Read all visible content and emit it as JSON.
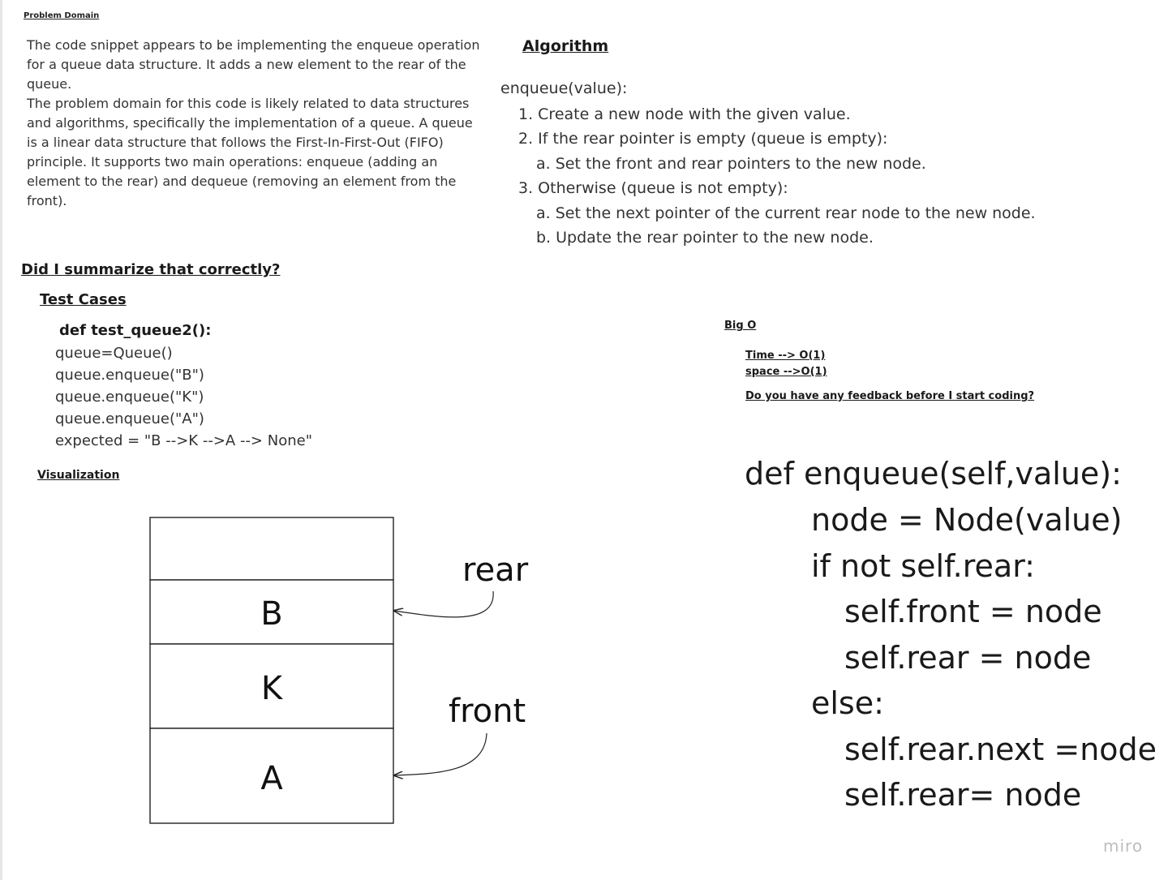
{
  "problem": {
    "title": "Problem Domain",
    "paragraph1": "The code snippet appears to be implementing the enqueue operation for a queue data structure. It adds a new element to the rear of the queue.",
    "paragraph2": "The problem domain for this code is likely related to data structures and algorithms, specifically the implementation of a queue. A queue is a linear data structure that follows the First-In-First-Out (FIFO) principle. It supports two main operations: enqueue (adding an element to the rear) and dequeue (removing an element from the front)."
  },
  "algorithm": {
    "title": "Algorithm",
    "head": "enqueue(value):",
    "steps": [
      "1. Create a new node with the given value.",
      "2. If the rear pointer is empty (queue is empty):",
      "a. Set the front and rear pointers to the new node.",
      "3. Otherwise (queue is not empty):",
      "a. Set the next pointer of the current rear node to the new node.",
      "b. Update the rear pointer to the new node."
    ]
  },
  "summary_question": "Did I summarize that correctly?",
  "test_cases": {
    "title": "Test Cases",
    "def_line": "def test_queue2():",
    "lines": [
      "queue=Queue()",
      "queue.enqueue(\"B\")",
      "queue.enqueue(\"K\")",
      "queue.enqueue(\"A\")",
      "expected = \"B -->K -->A --> None\""
    ]
  },
  "visualization": {
    "title": "Visualization",
    "cells": [
      "",
      "B",
      "K",
      "A"
    ],
    "rear_label": "rear",
    "front_label": "front"
  },
  "big_o": {
    "title": "Big O",
    "time": "Time --> O(1)",
    "space": "space -->O(1)",
    "feedback": "Do you have any feedback before I start coding?"
  },
  "code": {
    "lines": [
      "def enqueue(self,value):",
      "node = Node(value)",
      "if not self.rear:",
      "self.front = node",
      "self.rear = node",
      "else:",
      "self.rear.next =node",
      "self.rear= node"
    ]
  },
  "watermark": "miro"
}
